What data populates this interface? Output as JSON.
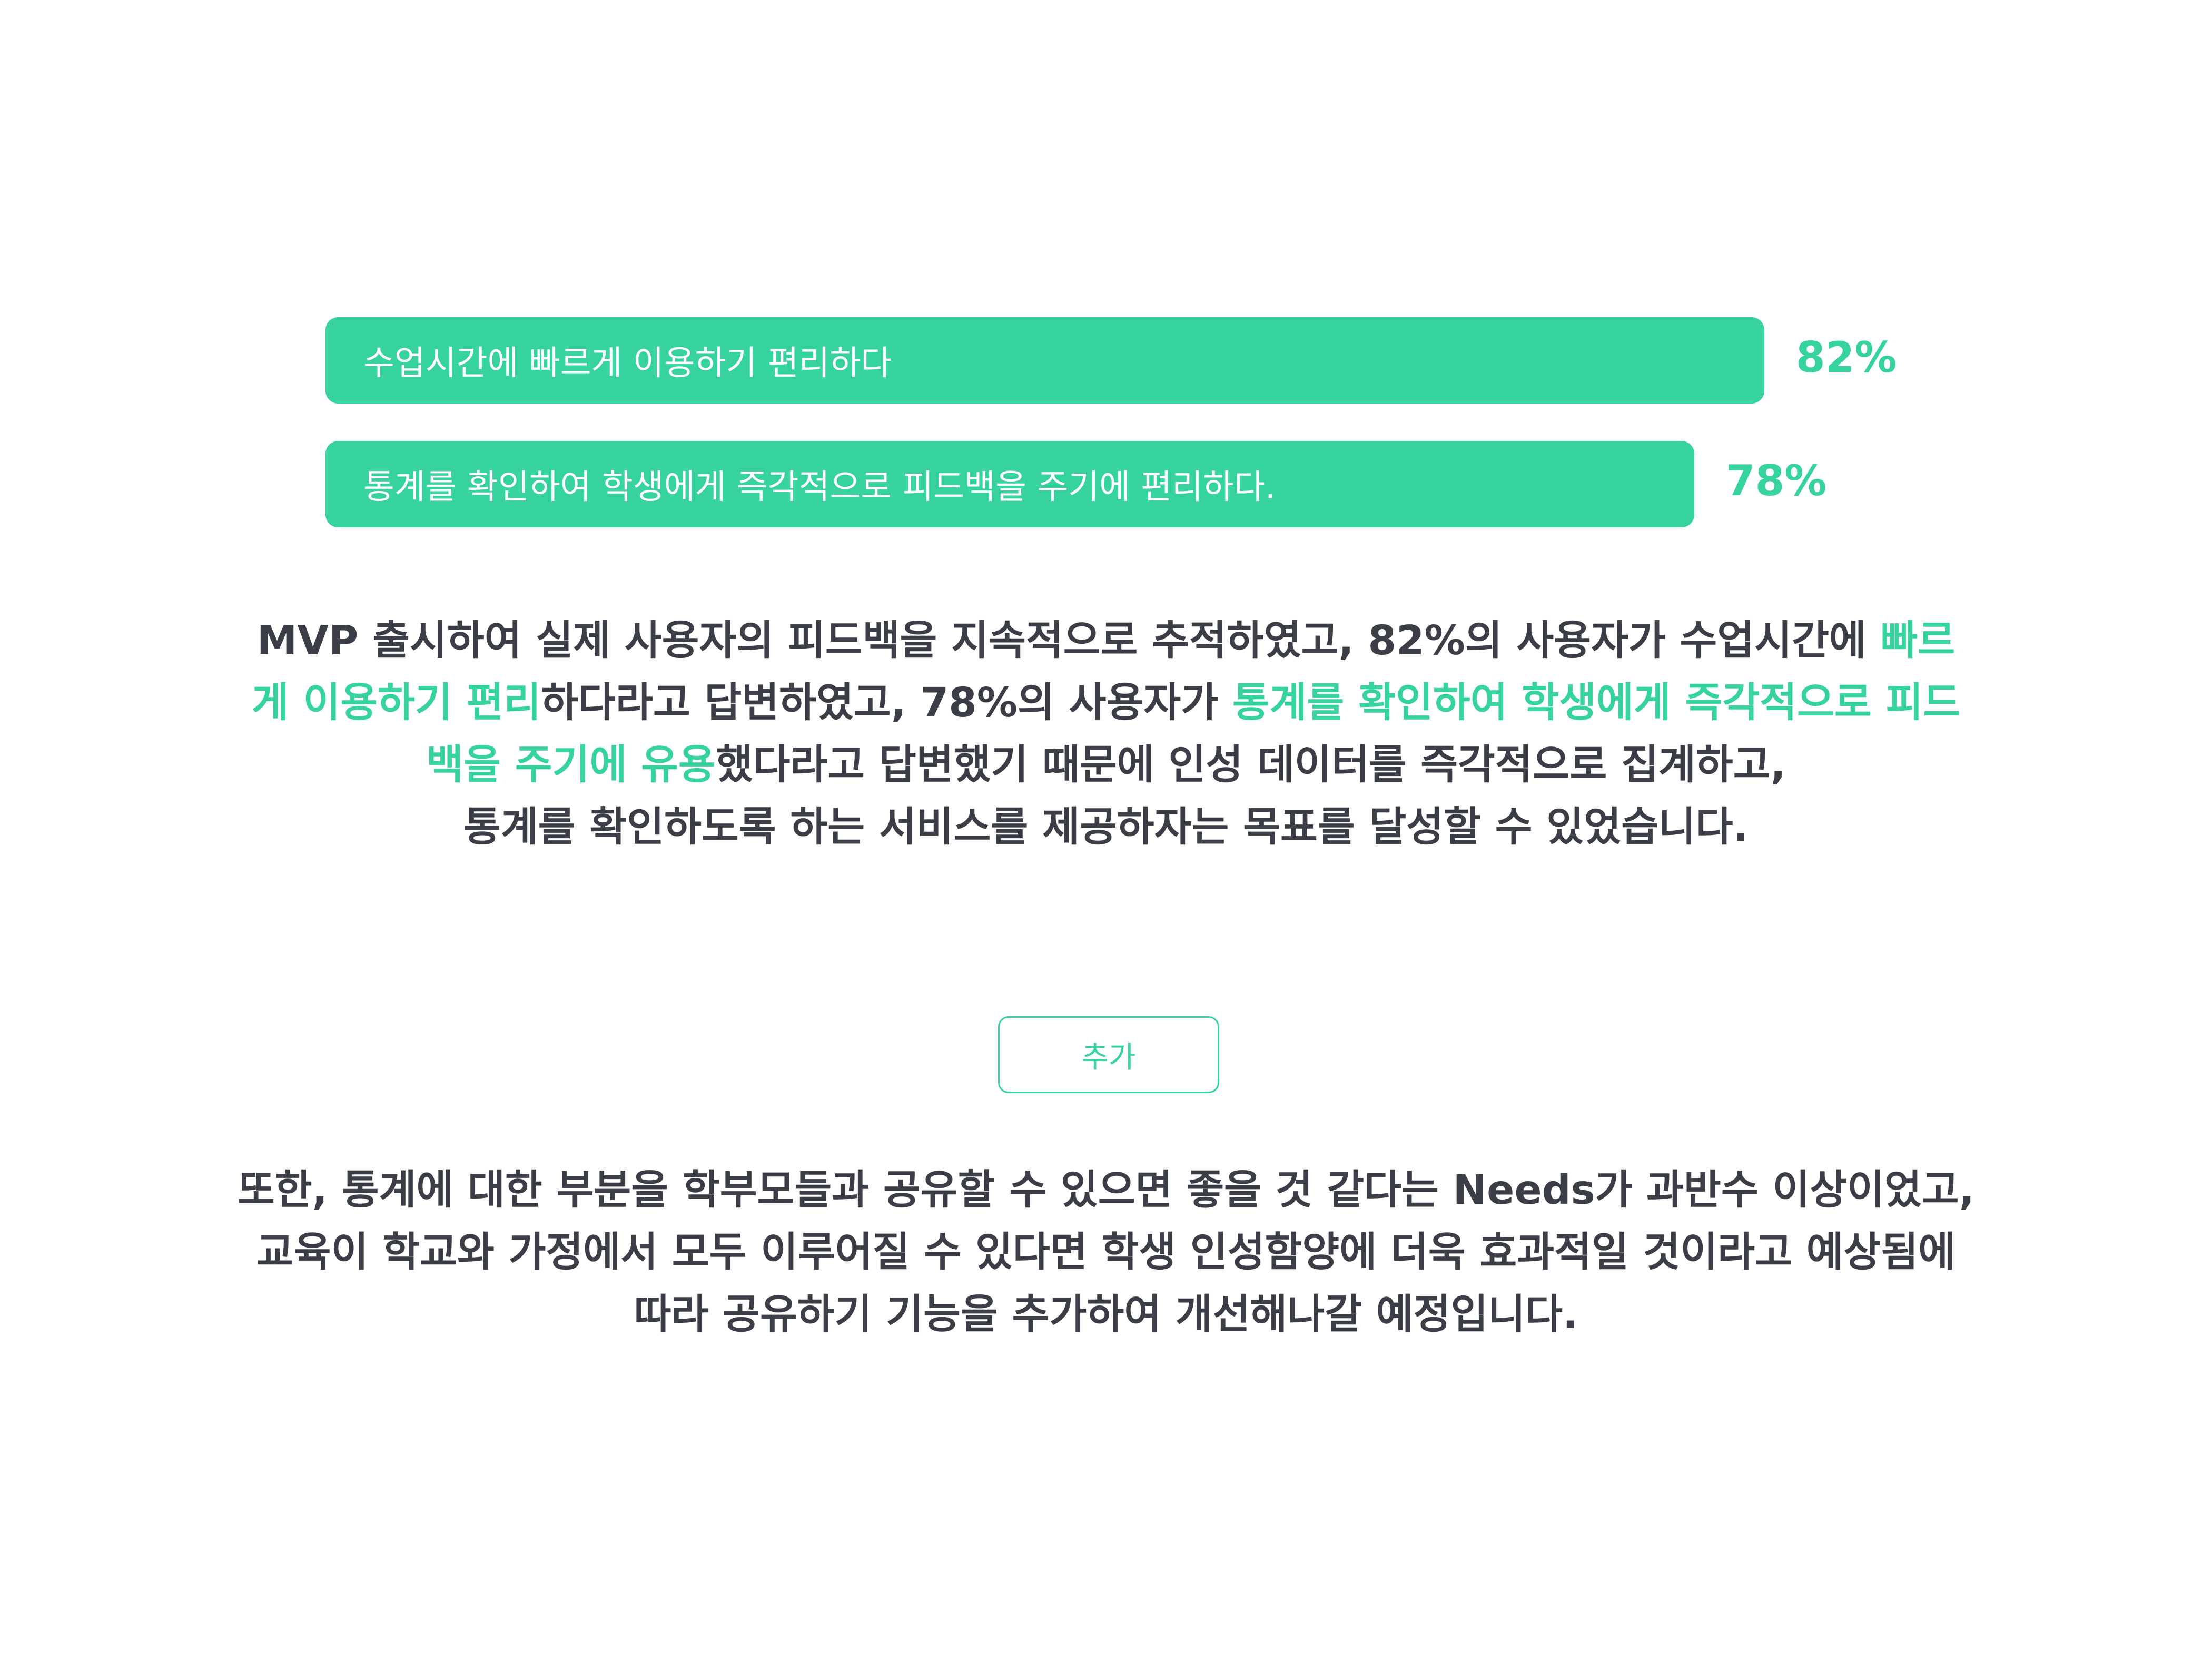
{
  "colors": {
    "accent": "#36d39d",
    "text": "#3b3e47",
    "background": "#ffffff"
  },
  "stats": [
    {
      "label": "수업시간에 빠르게 이용하기 편리하다",
      "value": "82%",
      "fraction": 0.82
    },
    {
      "label": "통계를 확인하여 학생에게 즉각적으로 피드백을 주기에 편리하다.",
      "value": "78%",
      "fraction": 0.78
    }
  ],
  "summary": {
    "line1": [
      {
        "text": "MVP 출시하여 실제 사용자의 피드백을 지속적으로 추적하였고, 82%의 사용자가 수업시간에 ",
        "highlight": false
      },
      {
        "text": "빠르",
        "highlight": true
      }
    ],
    "line2": [
      {
        "text": "게 이용하기 편리",
        "highlight": true
      },
      {
        "text": "하다라고 답변하였고, 78%의 사용자가 ",
        "highlight": false
      },
      {
        "text": "통계를 확인하여 학생에게 즉각적으로 피드",
        "highlight": true
      }
    ],
    "line3": [
      {
        "text": "백을 주기에 유용",
        "highlight": true
      },
      {
        "text": "했다라고 답변했기 때문에 인성 데이터를 즉각적으로 집계하고,",
        "highlight": false
      }
    ],
    "line4": [
      {
        "text": "통계를 확인하도록 하는 서비스를 제공하자는 목표를 달성할 수 있었습니다.",
        "highlight": false
      }
    ]
  },
  "add_button": {
    "label": "추가"
  },
  "followup": {
    "lines": [
      "또한, 통계에 대한 부분을 학부모들과 공유할 수 있으면 좋을 것 같다는 Needs가 과반수 이상이었고,",
      "교육이 학교와 가정에서 모두 이루어질 수 있다면 학생 인성함양에 더욱 효과적일 것이라고 예상됨에",
      "따라 공유하기 기능을 추가하여 개선해나갈 예정입니다."
    ]
  }
}
